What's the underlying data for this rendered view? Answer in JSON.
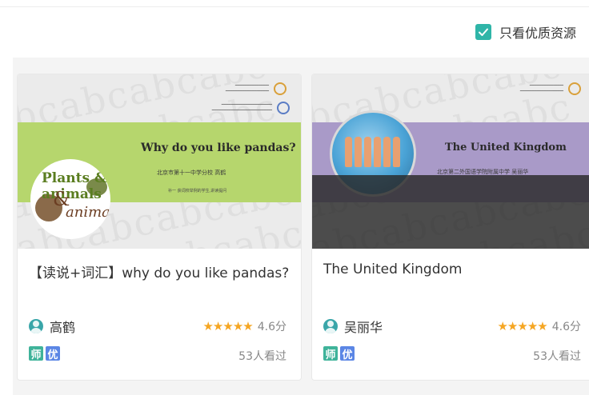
{
  "filter": {
    "label": "只看优质资源",
    "checked": true,
    "check_color": "#2fb5a8"
  },
  "cards": [
    {
      "title": "【读说+词汇】why do you like pandas?",
      "author": "高鹤",
      "rating": "4.6分",
      "views": "53人看过",
      "badges": [
        "师",
        "优"
      ],
      "thumbnail": {
        "slide_title": "Why do you like pandas?",
        "slide_subtitle": "北京市第十一中学分校 高鹤",
        "slide_note": "补一 获词校举例的学生,讲读提问",
        "logo_text": "Plants & animals"
      }
    },
    {
      "title": "The United Kingdom",
      "author": "吴丽华",
      "rating": "4.6分",
      "views": "53人看过",
      "badges": [
        "师",
        "优"
      ],
      "thumbnail": {
        "slide_title": "The United Kingdom",
        "slide_subtitle": "北京第二外国语学院附属中学  吴丽华"
      }
    }
  ],
  "colors": {
    "star": "#f5a623",
    "badge_teacher": "#3fb39a",
    "badge_quality": "#5b86e5",
    "band_green": "#b6d66d",
    "band_purple": "#a99ac8"
  }
}
